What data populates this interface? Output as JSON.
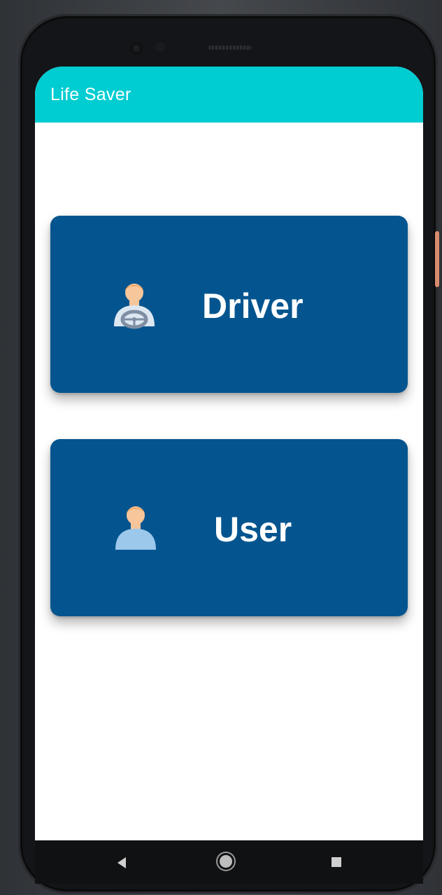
{
  "app": {
    "title": "Life Saver",
    "accent_color": "#00cdd2",
    "card_color": "#04558f"
  },
  "options": [
    {
      "key": "driver",
      "label": "Driver",
      "icon": "driver-avatar-icon"
    },
    {
      "key": "user",
      "label": "User",
      "icon": "user-avatar-icon"
    }
  ],
  "nav": {
    "back_icon": "back-triangle-icon",
    "home_icon": "home-circle-icon",
    "recent_icon": "recent-square-icon"
  }
}
